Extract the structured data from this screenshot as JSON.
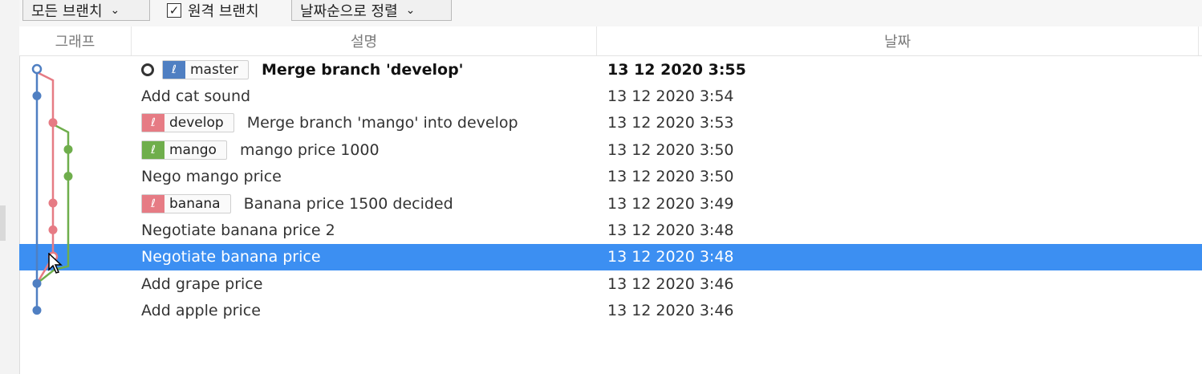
{
  "toolbar": {
    "branch_filter": "모든 브랜치",
    "remote_branch_label": "원격 브랜치",
    "remote_branch_checked": true,
    "sort_order": "날짜순으로 정렬"
  },
  "columns": {
    "graph": "그래프",
    "description": "설명",
    "date": "날짜"
  },
  "colors": {
    "blue": "#4f7fc2",
    "red": "#e67b84",
    "green": "#6fae4c",
    "selection": "#3c8ff2"
  },
  "commits": [
    {
      "description": "Merge branch 'develop'",
      "date": "13 12 2020 3:55",
      "bold": true,
      "head": true,
      "tag": {
        "label": "master",
        "color": "#4f7fc2"
      }
    },
    {
      "description": "Add cat sound",
      "date": "13 12 2020 3:54"
    },
    {
      "description": "Merge branch 'mango' into develop",
      "date": "13 12 2020 3:53",
      "tag": {
        "label": "develop",
        "color": "#e67b84"
      }
    },
    {
      "description": "mango price 1000",
      "date": "13 12 2020 3:50",
      "tag": {
        "label": "mango",
        "color": "#6fae4c"
      }
    },
    {
      "description": "Nego mango price",
      "date": "13 12 2020 3:50"
    },
    {
      "description": "Banana price 1500 decided",
      "date": "13 12 2020 3:49",
      "tag": {
        "label": "banana",
        "color": "#e67b84"
      }
    },
    {
      "description": "Negotiate banana price 2",
      "date": "13 12 2020 3:48"
    },
    {
      "description": "Negotiate banana price",
      "date": "13 12 2020 3:48",
      "selected": true
    },
    {
      "description": "Add grape price",
      "date": "13 12 2020 3:46"
    },
    {
      "description": "Add apple price",
      "date": "13 12 2020 3:46"
    }
  ]
}
